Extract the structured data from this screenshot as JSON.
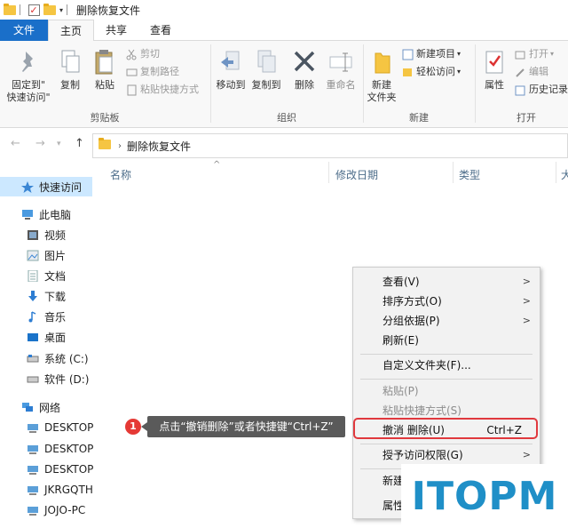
{
  "window": {
    "title": "删除恢复文件"
  },
  "ribbon_tabs": [
    "文件",
    "主页",
    "共享",
    "查看"
  ],
  "ribbon": {
    "clipboard": {
      "pin_l1": "固定到\"",
      "pin_l2": "快速访问\"",
      "copy": "复制",
      "paste": "粘贴",
      "cut": "剪切",
      "copy_path": "复制路径",
      "paste_shortcut": "粘贴快捷方式",
      "label": "剪贴板"
    },
    "organize": {
      "move_to": "移动到",
      "copy_to": "复制到",
      "delete": "删除",
      "rename": "重命名",
      "label": "组织"
    },
    "new": {
      "new_folder_l1": "新建",
      "new_folder_l2": "文件夹",
      "new_item": "新建项目",
      "easy_access": "轻松访问",
      "label": "新建"
    },
    "open": {
      "properties": "属性",
      "open": "打开",
      "edit": "编辑",
      "history": "历史记录",
      "label": "打开"
    }
  },
  "address": {
    "path": "删除恢复文件"
  },
  "columns": [
    "名称",
    "修改日期",
    "类型",
    "大"
  ],
  "nav_items": [
    {
      "label": "快速访问",
      "icon": "star-icon"
    },
    {
      "label": "此电脑",
      "icon": "computer-icon"
    },
    {
      "label": "视频",
      "icon": "video-icon"
    },
    {
      "label": "图片",
      "icon": "picture-icon"
    },
    {
      "label": "文档",
      "icon": "document-icon"
    },
    {
      "label": "下载",
      "icon": "download-icon"
    },
    {
      "label": "音乐",
      "icon": "music-icon"
    },
    {
      "label": "桌面",
      "icon": "desktop-icon"
    },
    {
      "label": "系统 (C:)",
      "icon": "drive-icon"
    },
    {
      "label": "软件 (D:)",
      "icon": "drive-icon"
    },
    {
      "label": "网络",
      "icon": "network-icon"
    },
    {
      "label": "DESKTOP",
      "icon": "pc-icon"
    },
    {
      "label": "DESKTOP",
      "icon": "pc-icon"
    },
    {
      "label": "DESKTOP",
      "icon": "pc-icon"
    },
    {
      "label": "JKRGQTH",
      "icon": "pc-icon"
    },
    {
      "label": "JOJO-PC",
      "icon": "pc-icon"
    }
  ],
  "context_menu": [
    {
      "label": "查看(V)",
      "submenu": true
    },
    {
      "label": "排序方式(O)",
      "submenu": true
    },
    {
      "label": "分组依据(P)",
      "submenu": true
    },
    {
      "label": "刷新(E)"
    },
    {
      "label": "自定义文件夹(F)..."
    },
    {
      "label": "粘贴(P)",
      "disabled": true
    },
    {
      "label": "粘贴快捷方式(S)",
      "disabled": true
    },
    {
      "label": "撤消 删除(U)",
      "shortcut": "Ctrl+Z"
    },
    {
      "label": "授予访问权限(G)",
      "submenu": true
    },
    {
      "label": "新建"
    },
    {
      "label": "属性"
    }
  ],
  "annotation": {
    "step": "1",
    "text": "点击“撤销删除”或者快捷键“Ctrl+Z”"
  },
  "watermark": "ITOPM",
  "colors": {
    "file_tab": "#1a6fc9",
    "selection": "#cce8ff",
    "highlight": "#e0393e",
    "watermark": "#1f8fc7"
  }
}
